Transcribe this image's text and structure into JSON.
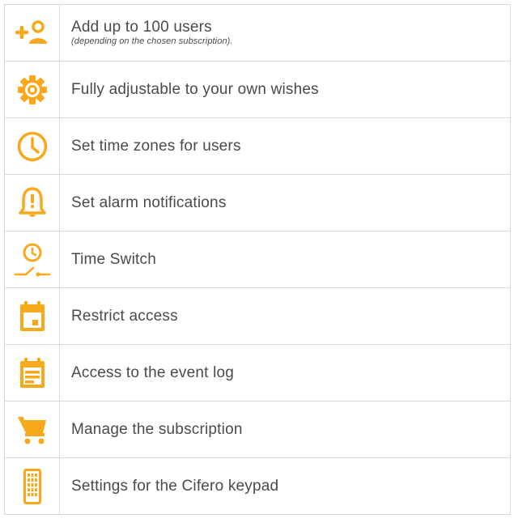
{
  "accent_color": "#f7a81b",
  "features": [
    {
      "icon": "add-user-icon",
      "label": "Add up to 100 users",
      "note": "(depending on the chosen subscription)."
    },
    {
      "icon": "gear-icon",
      "label": "Fully adjustable to your own wishes",
      "note": ""
    },
    {
      "icon": "clock-icon",
      "label": "Set time zones for users",
      "note": ""
    },
    {
      "icon": "bell-alert-icon",
      "label": "Set alarm notifications",
      "note": ""
    },
    {
      "icon": "time-switch-icon",
      "label": "Time Switch",
      "note": ""
    },
    {
      "icon": "calendar-icon",
      "label": "Restrict access",
      "note": ""
    },
    {
      "icon": "event-log-icon",
      "label": "Access to the event log",
      "note": ""
    },
    {
      "icon": "cart-icon",
      "label": "Manage the subscription",
      "note": ""
    },
    {
      "icon": "keypad-icon",
      "label": "Settings for the Cifero keypad",
      "note": ""
    }
  ]
}
